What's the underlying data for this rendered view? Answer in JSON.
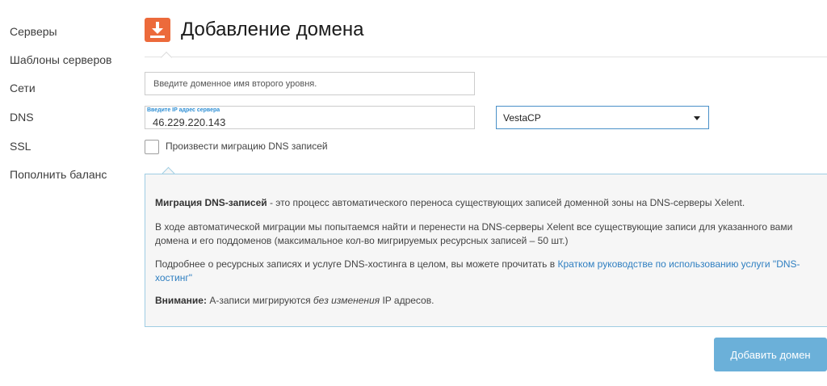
{
  "sidebar": {
    "items": [
      {
        "label": "Серверы"
      },
      {
        "label": "Шаблоны серверов"
      },
      {
        "label": "Сети"
      },
      {
        "label": "DNS"
      },
      {
        "label": "SSL"
      },
      {
        "label": "Пополнить баланс"
      }
    ]
  },
  "header": {
    "icon": "download-icon",
    "title": "Добавление домена"
  },
  "form": {
    "domain_placeholder": "Введите доменное имя второго уровня.",
    "ip_label": "Введите IP адрес сервера",
    "ip_value": "46.229.220.143",
    "panel_select": "VestaCP",
    "migrate_checkbox_label": "Произвести миграцию DNS записей",
    "migrate_checked": false
  },
  "info": {
    "p1_bold": "Миграция DNS-записей",
    "p1_text": " - это процесс автоматического переноса существующих записей доменной зоны на DNS-серверы Xelent.",
    "p2": "В ходе автоматической миграции мы попытаемся найти и перенести на DNS-серверы Xelent все существующие записи для указанного вами домена и его поддоменов (максимальное кол-во мигрируемых ресурсных записей – 50 шт.)",
    "p3_text": "Подробнее о ресурсных записях и услуге DNS-хостинга в целом, вы можете прочитать в ",
    "p3_link": "Кратком руководстве по использованию услуги \"DNS-хостинг\"",
    "p4_bold": "Внимание:",
    "p4_text1": " А-записи мигрируются ",
    "p4_italic": "без изменения",
    "p4_text2": " IP адресов."
  },
  "actions": {
    "submit_label": "Добавить домен"
  },
  "colors": {
    "accent_orange": "#ec6a3b",
    "button_blue": "#6bb0d9",
    "link_blue": "#2f7fc1",
    "panel_border": "#9fcde3"
  }
}
